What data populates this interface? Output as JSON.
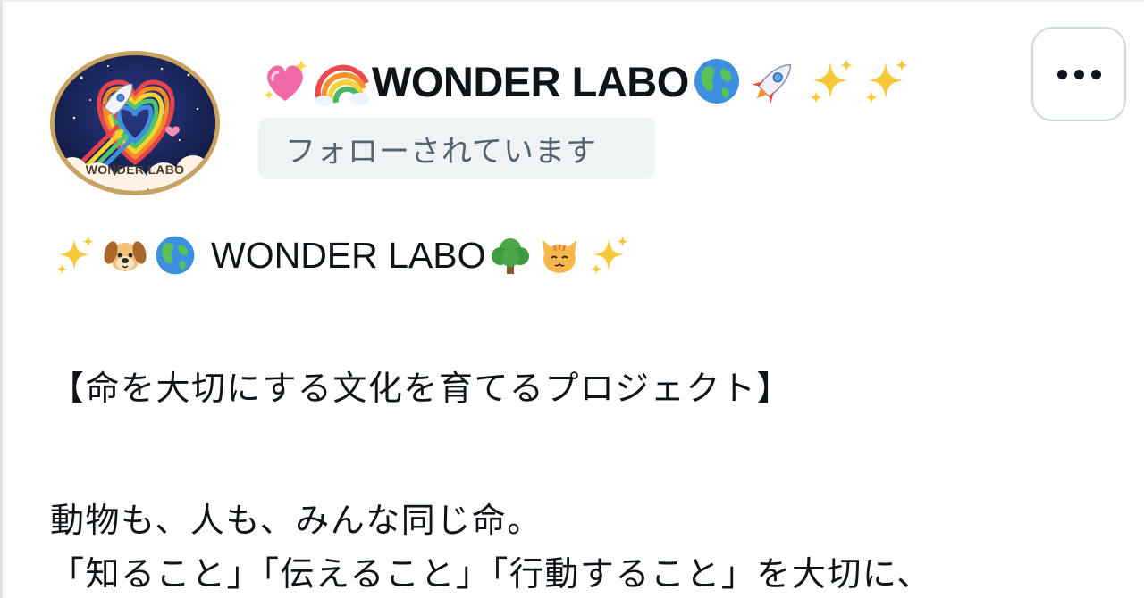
{
  "profile": {
    "name_text": "WONDER LABO",
    "avatar_caption": "WONDER LABO",
    "follow_status": "フォローされています",
    "name_emojis_before": [
      "sparkling-heart-icon",
      "rainbow-icon"
    ],
    "name_emojis_after": [
      "globe-icon",
      "rocket-icon",
      "sparkles-icon",
      "sparkles-icon"
    ]
  },
  "menu": {
    "more_label": "More options"
  },
  "bio": {
    "title_text": "WONDER LABO",
    "title_emojis_before": [
      "sparkles-icon",
      "dog-face-icon",
      "globe-icon"
    ],
    "title_emojis_after": [
      "tree-icon",
      "cat-face-icon",
      "sparkles-icon"
    ],
    "project_line": "【命を大切にする文化を育てるプロジェクト】",
    "line_1": "動物も、人も、みんな同じ命。",
    "line_2": "「知ること」「伝えること」「行動すること」を大切に、"
  },
  "colors": {
    "text_primary": "#0f1419",
    "text_secondary": "#536471",
    "badge_bg": "#eff3f4",
    "border": "#cfd9de",
    "avatar_ring": "#c9a160"
  }
}
